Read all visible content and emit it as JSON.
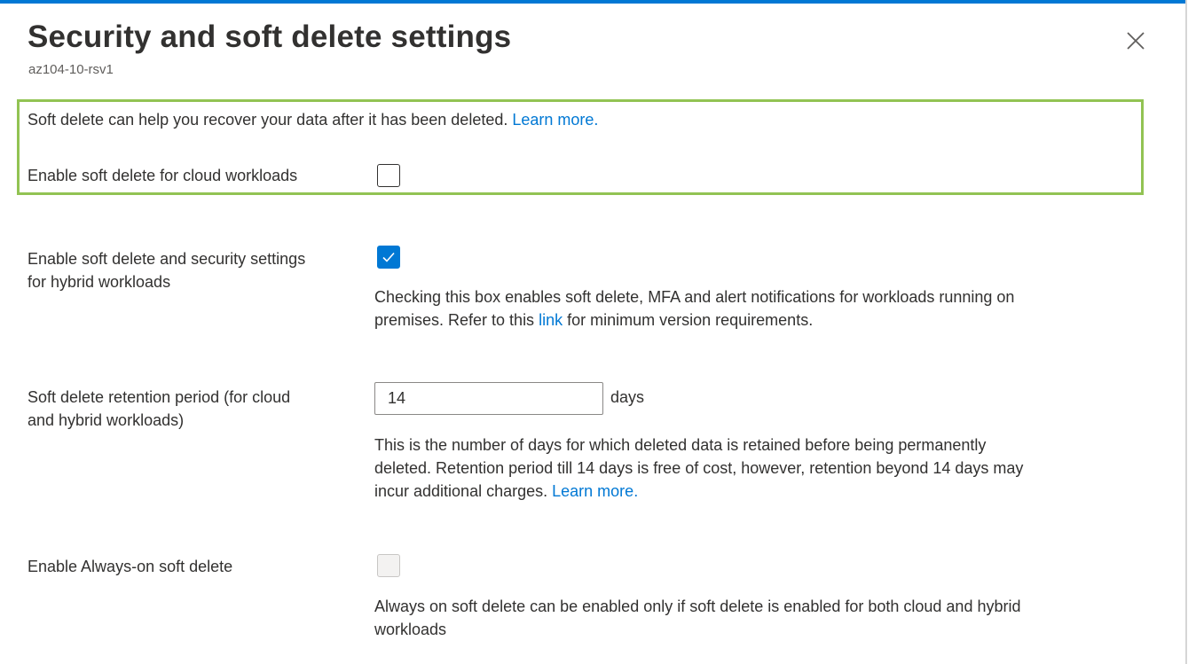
{
  "header": {
    "title": "Security and soft delete settings",
    "subtitle": "az104-10-rsv1",
    "close_icon": "close-x-icon"
  },
  "cloud_section": {
    "intro_text": "Soft delete can help you recover your data after it has been deleted.",
    "intro_link": "Learn more.",
    "checkbox_label": "Enable soft delete for cloud workloads",
    "checked": false,
    "highlight_color": "#92c353"
  },
  "hybrid_section": {
    "label_line1": "Enable soft delete and security settings",
    "label_line2": "for hybrid workloads",
    "checked": true,
    "desc_line1": "Checking this box enables soft delete, MFA and alert notifications for workloads running on",
    "desc_line2_pre": "premises. Refer to this",
    "desc_link": "link",
    "desc_line2_post": "for minimum version requirements."
  },
  "retention_section": {
    "label_line1": "Soft delete retention period (for cloud",
    "label_line2": "and hybrid workloads)",
    "value": "14",
    "unit": "days",
    "desc_line1": "This is the number of days for which deleted data is retained before being permanently",
    "desc_line2": "deleted. Retention period till 14 days is free of cost, however, retention beyond 14 days may",
    "desc_line3_pre": "incur additional charges.",
    "desc_link": "Learn more."
  },
  "always_on_section": {
    "label": "Enable Always-on soft delete",
    "checked": false,
    "disabled": true,
    "desc_line1": "Always on soft delete can be enabled only if soft delete is enabled for both cloud and hybrid",
    "desc_line2": "workloads"
  },
  "colors": {
    "accent": "#0078d4",
    "text": "#323130",
    "subtle": "#605e5c"
  }
}
